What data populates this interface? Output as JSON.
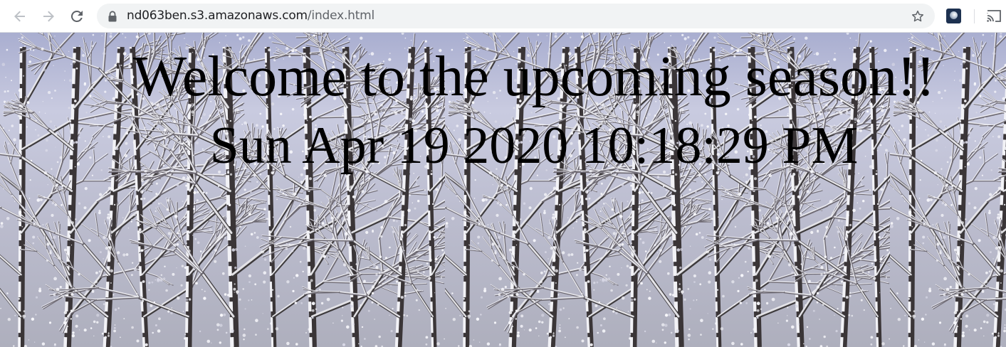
{
  "browser": {
    "url_host": "nd063ben.s3.amazonaws.com",
    "url_path": "/index.html",
    "icons": {
      "back": "arrow-left-icon",
      "forward": "arrow-right-icon",
      "reload": "reload-icon",
      "lock": "lock-icon",
      "bookmark": "star-icon",
      "extension": "extension-icon",
      "cast": "cast-icon"
    },
    "colors": {
      "omnibox_bg": "#f1f3f4",
      "text": "#202124",
      "path_text": "#5f6368",
      "icon": "#5f6368"
    }
  },
  "page": {
    "headline": "Welcome to the upcoming season!!",
    "datetime": "Sun Apr 19 2020 10:18:29 PM",
    "background": "snowy winter forest image (tiled)",
    "colors": {
      "text": "#000000",
      "sky": "#b4b8d2"
    }
  }
}
